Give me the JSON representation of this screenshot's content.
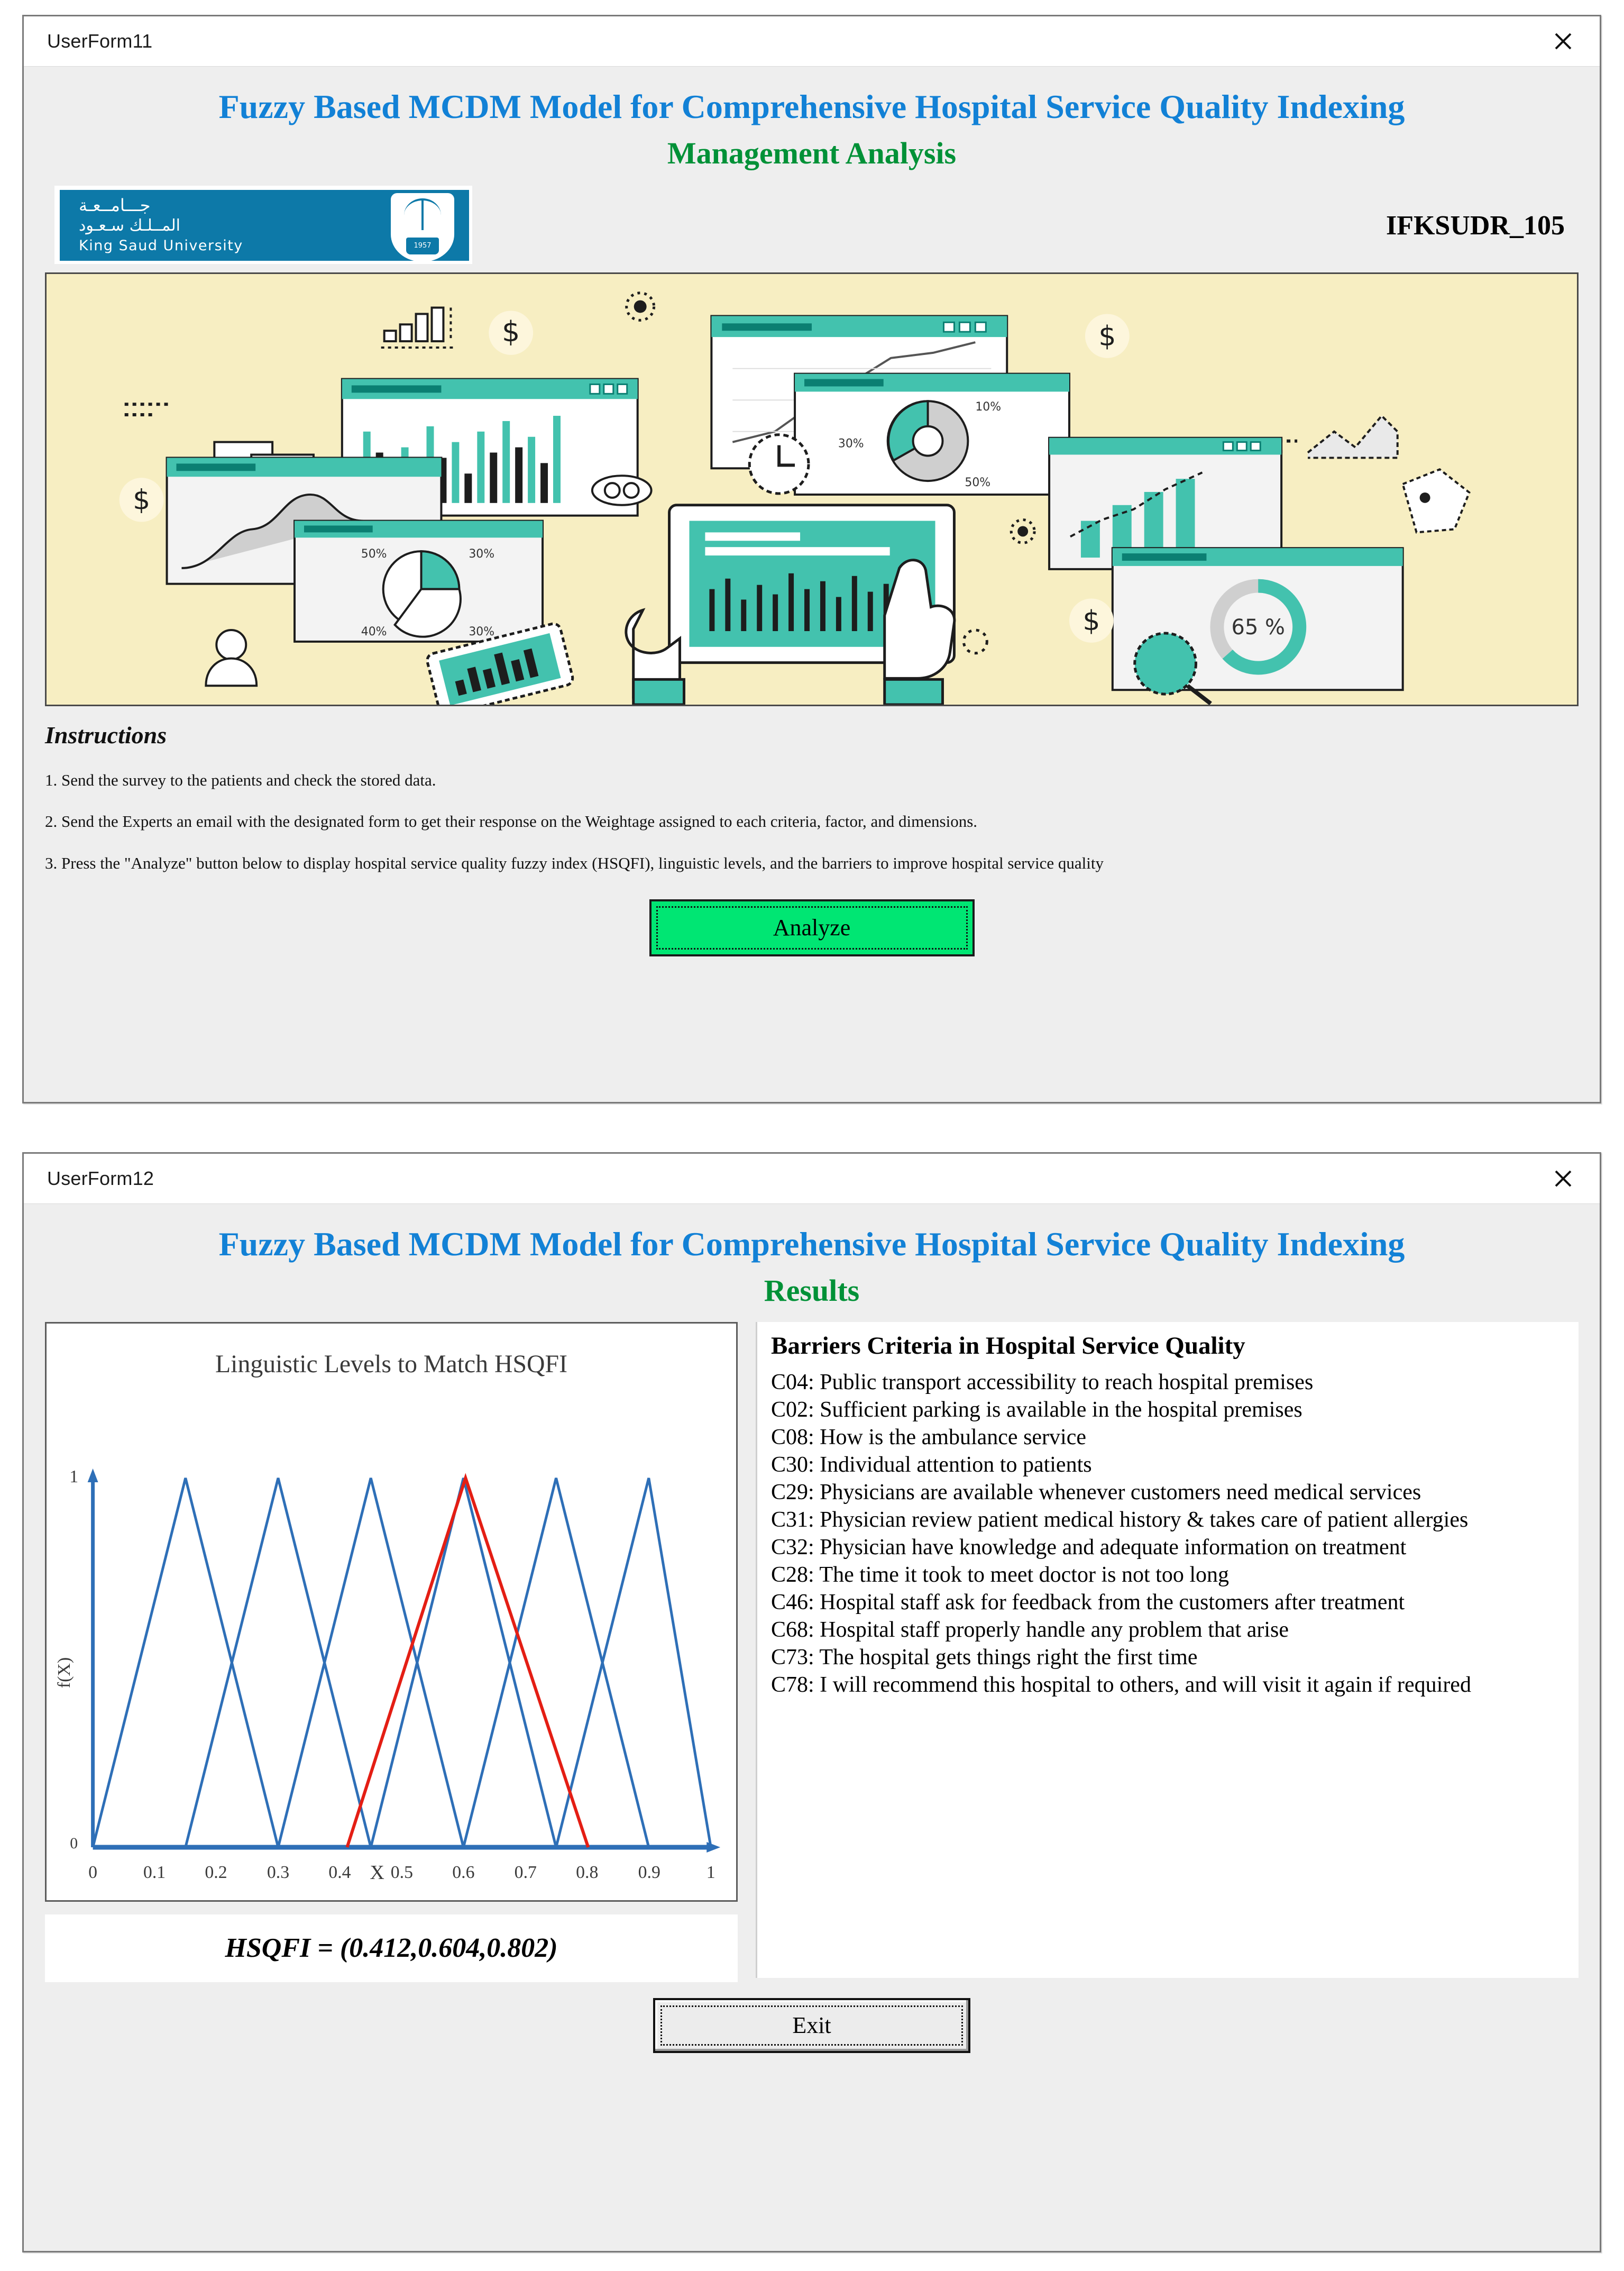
{
  "form1": {
    "window_title": "UserForm11",
    "close_label": "close",
    "title": "Fuzzy Based MCDM Model for Comprehensive Hospital Service Quality Indexing",
    "subtitle": "Management Analysis",
    "grant_id": "IFKSUDR_105",
    "logo": {
      "arabic_line1": "جـــامــعـة",
      "arabic_line2": "المــلـك سـعـود",
      "english": "King Saud University",
      "shield_year": "1957"
    },
    "instructions_heading": "Instructions",
    "instructions": [
      "1. Send the survey to the patients and check the stored data.",
      "2. Send the Experts an email with the designated form to get their response on the Weightage assigned to each criteria, factor, and dimensions.",
      "3. Press the \"Analyze\" button below to display hospital service quality fuzzy index (HSQFI), linguistic levels, and the barriers to improve hospital service quality"
    ],
    "analyze_label": "Analyze"
  },
  "form2": {
    "window_title": "UserForm12",
    "close_label": "close",
    "title": "Fuzzy Based MCDM Model for Comprehensive Hospital Service Quality Indexing",
    "subtitle": "Results",
    "hsqfi_label": "HSQFI =  (0.412,0.604,0.802)",
    "barriers_title": "Barriers Criteria in Hospital Service Quality",
    "barriers": [
      "C04: Public transport accessibility to reach hospital premises",
      "C02: Sufficient parking is available in the hospital premises",
      "C08: How is the ambulance service",
      "C30: Individual attention to patients",
      "C29: Physicians are available whenever customers need medical services",
      "C31: Physician review patient medical history & takes care of patient allergies",
      "C32: Physician have knowledge and adequate information on treatment",
      "C28: The time it took to meet doctor is not too long",
      "C46: Hospital staff ask for feedback from the customers after treatment",
      "C68: Hospital staff properly handle any problem that arise",
      "C73: The hospital gets things right the first time",
      "C78: I will recommend this hospital to others, and will visit it again if required"
    ],
    "exit_label": "Exit"
  },
  "chart_data": {
    "type": "line",
    "title": "Linguistic Levels to Match HSQFI",
    "xlabel": "X",
    "ylabel": "f(X)",
    "xlim": [
      0,
      1
    ],
    "ylim": [
      0,
      1
    ],
    "xticks": [
      "0",
      "0.1",
      "0.2",
      "0.3",
      "0.4",
      "0.5",
      "0.6",
      "0.7",
      "0.8",
      "0.9",
      "1"
    ],
    "yticks": [
      "0",
      "1"
    ],
    "grid": false,
    "legend": "none",
    "series": [
      {
        "name": "L1",
        "color": "#2e6fb7",
        "x": [
          0.0,
          0.0,
          0.15,
          0.3
        ],
        "y": [
          0,
          0,
          1,
          0
        ]
      },
      {
        "name": "L2",
        "color": "#2e6fb7",
        "x": [
          0.15,
          0.3,
          0.45
        ],
        "y": [
          0,
          1,
          0
        ]
      },
      {
        "name": "L3",
        "color": "#2e6fb7",
        "x": [
          0.3,
          0.45,
          0.6
        ],
        "y": [
          0,
          1,
          0
        ]
      },
      {
        "name": "L4",
        "color": "#2e6fb7",
        "x": [
          0.45,
          0.6,
          0.75
        ],
        "y": [
          0,
          1,
          0
        ]
      },
      {
        "name": "L5",
        "color": "#2e6fb7",
        "x": [
          0.6,
          0.75,
          0.9
        ],
        "y": [
          0,
          1,
          0
        ]
      },
      {
        "name": "L6",
        "color": "#2e6fb7",
        "x": [
          0.75,
          0.9,
          1.0
        ],
        "y": [
          0,
          1,
          0
        ]
      },
      {
        "name": "HSQFI",
        "color": "#e41e14",
        "x": [
          0.412,
          0.604,
          0.802
        ],
        "y": [
          0,
          1,
          0
        ]
      }
    ],
    "annotations": [
      "HSQFI = (0.412,0.604,0.802)"
    ]
  }
}
